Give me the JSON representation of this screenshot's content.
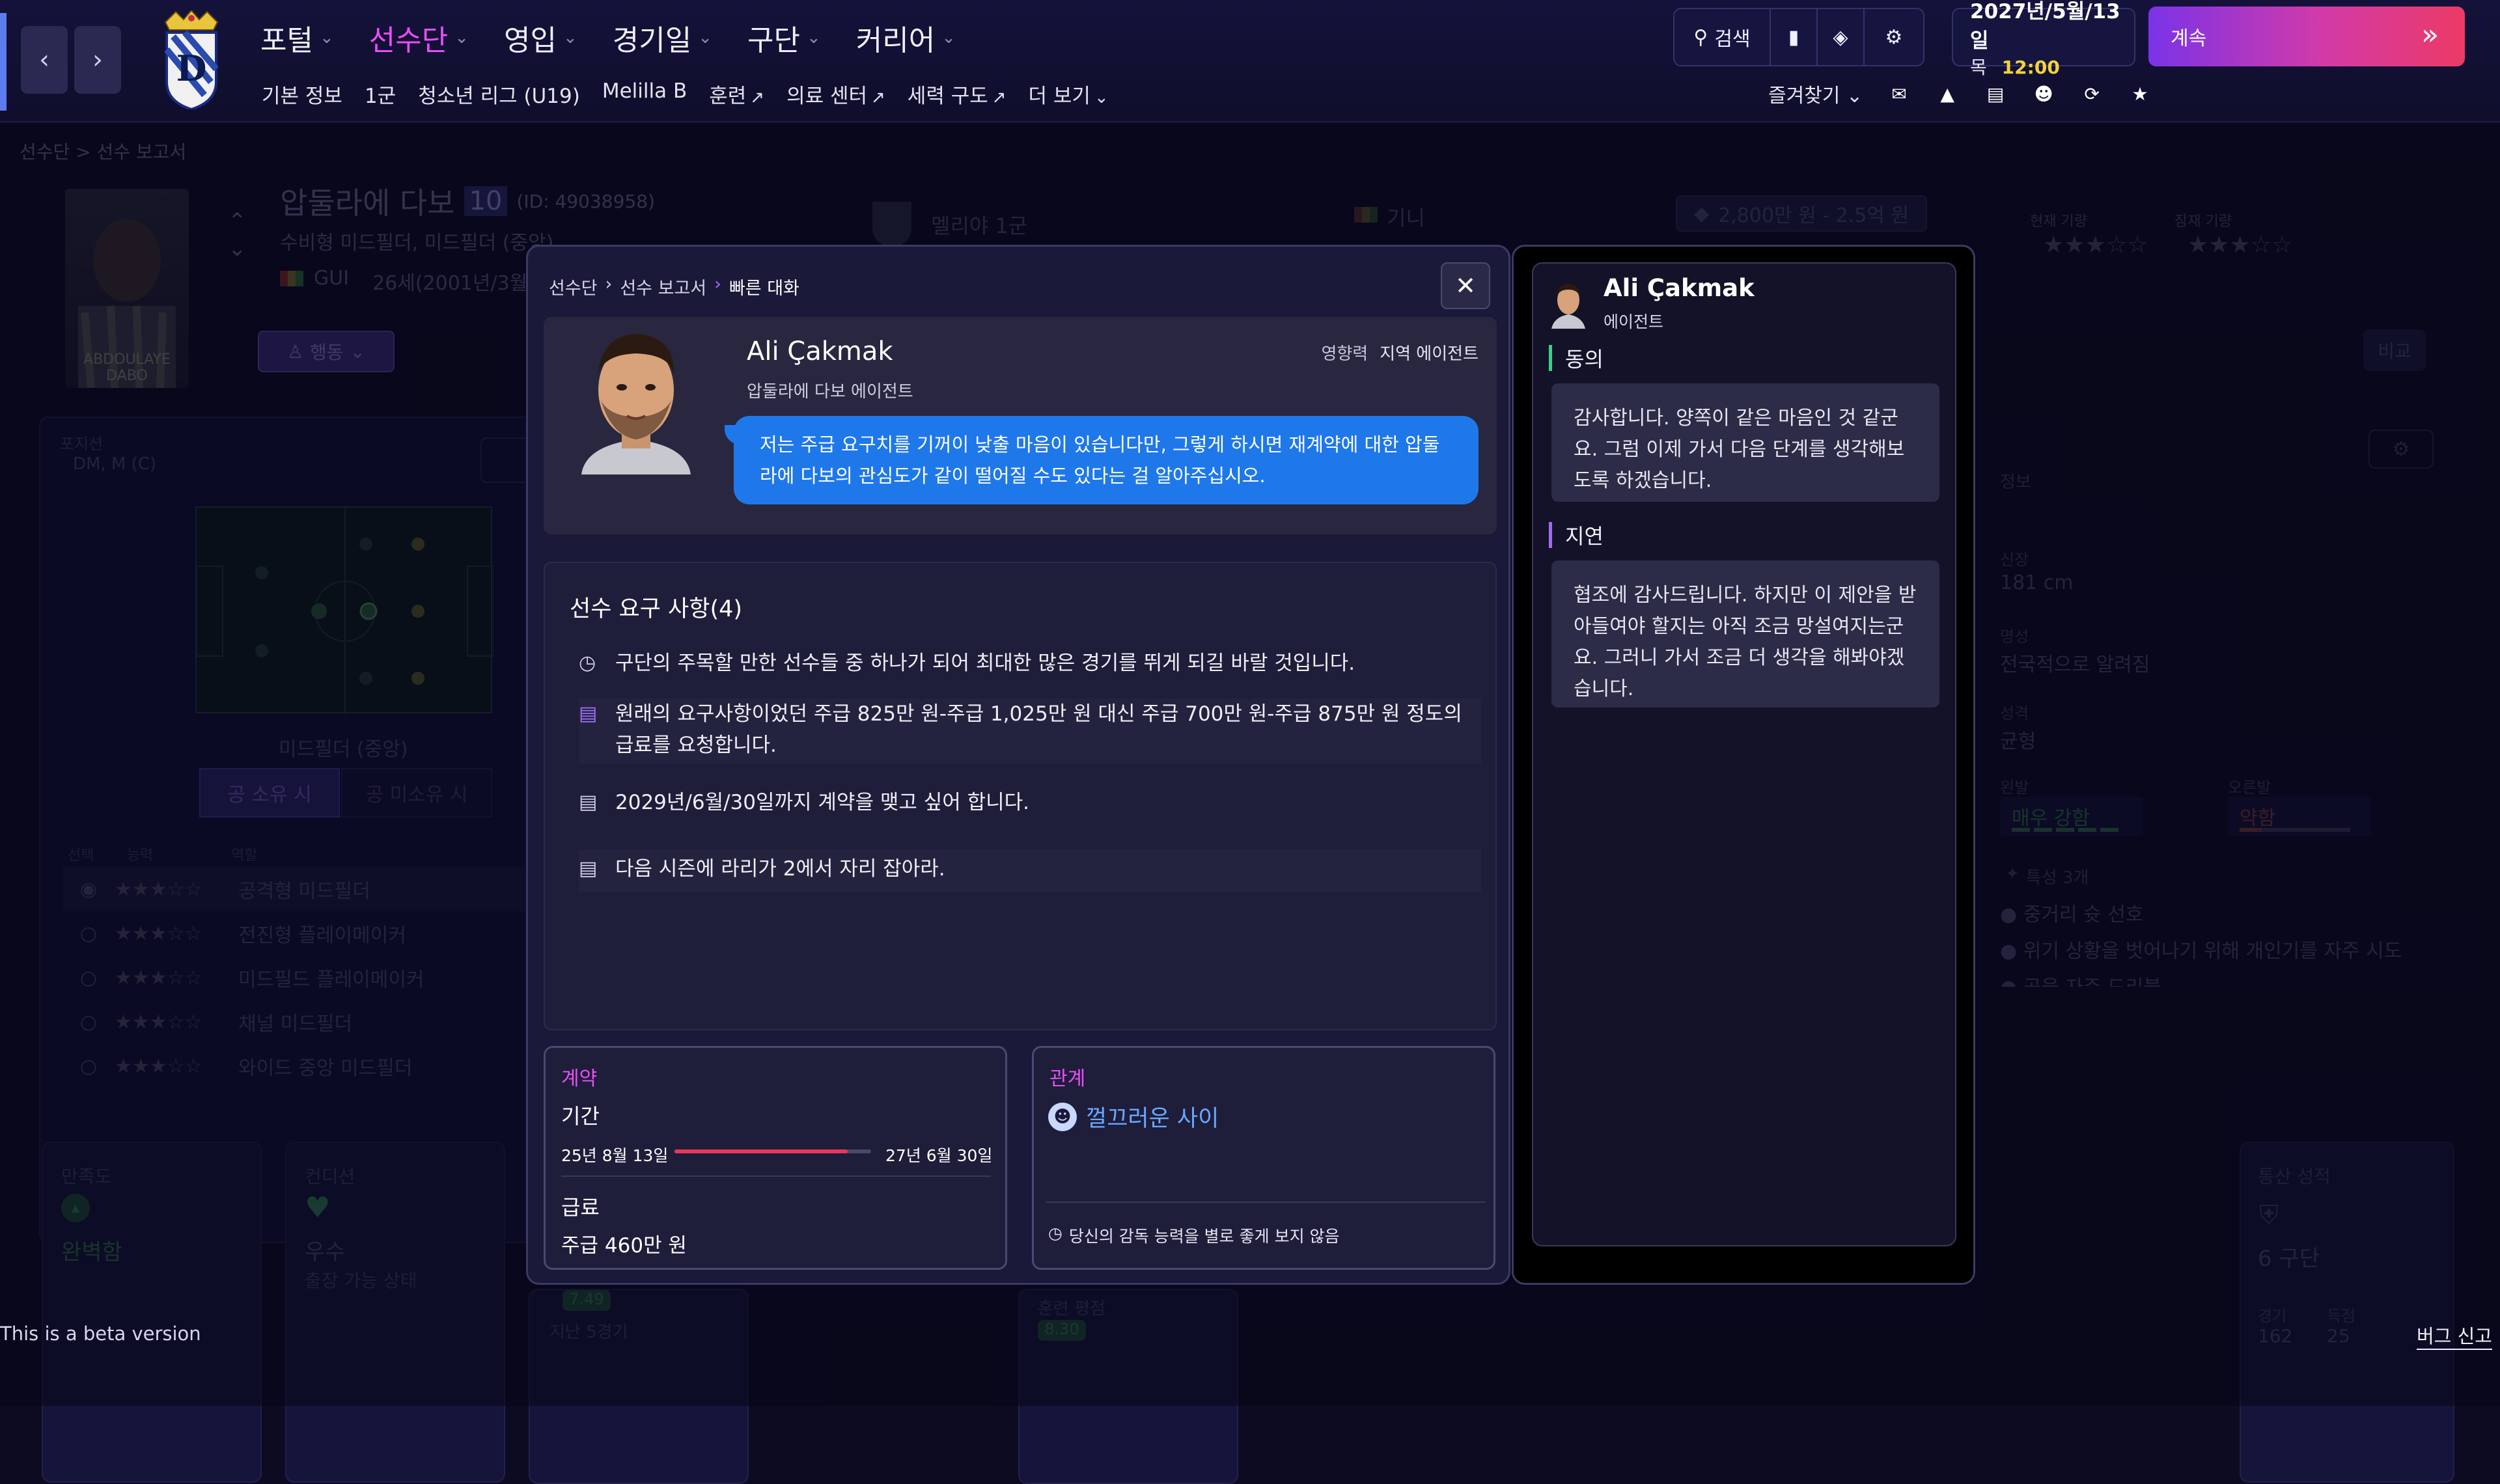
{
  "header": {
    "nav": {
      "portal": "포털",
      "squad": "선수단",
      "recruit": "영입",
      "schedule": "경기일",
      "club": "구단",
      "career": "커리어"
    },
    "subnav": [
      "기본 정보",
      "1군",
      "청소년 리그 (U19)",
      "Melilla B",
      "훈련",
      "의료 센터",
      "세력 구도",
      "더 보기"
    ],
    "search_label": "검색",
    "date_line1": "2027년/5월/13일",
    "date_line2_day": "목",
    "date_line2_time": "12:00",
    "continue_label": "계속",
    "favorites_label": "즐겨찾기"
  },
  "background": {
    "breadcrumb": "선수단 > 선수 보고서",
    "player_name": "압둘라에 다보",
    "player_number": "10",
    "player_id": "(ID: 49038958)",
    "player_role": "수비형 미드필더, 미드필더 (중앙)",
    "player_nation_code": "GUI",
    "player_age": "26세(2001년/3월/",
    "player_photo_caption": "ABDOULAYE DABO",
    "action_btn": "행동",
    "club_label": "멜리야 1군",
    "nation_label": "기니",
    "value_label": "2,800만 원 - 2.5억 원",
    "current_ability": "현재 기량",
    "potential_ability": "잠재 기량",
    "compare": "비교",
    "position_label": "포지션",
    "position_value": "DM, M (C)",
    "pitch_caption": "미드필더 (중앙)",
    "possession_on": "공 소유 시",
    "possession_off": "공 미소유 시",
    "role_col_select": "선택",
    "role_col_ability": "능력",
    "role_col_role": "역할",
    "roles": [
      "공격형 미드필더",
      "전진형 플레이메이커",
      "미드필드 플레이메이커",
      "채널 미드필더",
      "와이드 중앙 미드필더"
    ],
    "info_label": "정보",
    "height_label": "신장",
    "height_value": "181 cm",
    "fame_label": "명성",
    "fame_value": "전국적으로 알려짐",
    "personality_label": "성격",
    "personality_value": "균형",
    "left_foot_label": "왼발",
    "left_foot_value": "매우 강함",
    "right_foot_label": "오른발",
    "right_foot_value": "약함",
    "traits_label": "특성 3개",
    "traits": [
      "중거리 슛 선호",
      "위기 상황을 벗어나기 위해 개인기를 자주 시도",
      "공을 자주 드리블"
    ],
    "morale_label": "만족도",
    "morale_value": "완벽함",
    "condition_label": "컨디션",
    "condition_value": "우수",
    "condition_sub": "출장 가능 상태",
    "rating_value": "7.49",
    "last5_label": "지난 5경기",
    "training_label": "훈련 평점",
    "training_value": "8.30",
    "career_label": "통산 성적",
    "career_club": "6 구단",
    "career_matches_label": "경기",
    "career_matches": "162",
    "career_goals_label": "득점",
    "career_goals": "25",
    "beta_notice": "This is a beta version",
    "bug_report": "버그 신고"
  },
  "modal": {
    "breadcrumb_1": "선수단",
    "breadcrumb_2": "선수 보고서",
    "breadcrumb_3": "빠른 대화",
    "agent_name": "Ali Çakmak",
    "agent_subtitle": "압둘라에 다보 에이전트",
    "influence_label": "영향력",
    "influence_value": "지역 에이전트",
    "speech": "저는 주급 요구치를 기꺼이 낮출 마음이 있습니다만, 그렇게 하시면 재계약에 대한 압둘라에 다보의 관심도가 같이 떨어질 수도 있다는 걸 알아주십시오.",
    "requirements_title": "선수 요구 사항(4)",
    "requirements": [
      "구단의 주목할 만한 선수들 중 하나가 되어 최대한 많은 경기를 뛰게 되길 바랄 것입니다.",
      "원래의 요구사항이었던 주급 825만 원-주급 1,025만 원 대신 주급 700만 원-주급 875만 원 정도의 급료를 요청합니다.",
      "2029년/6월/30일까지 계약을 맺고 싶어 합니다.",
      "다음 시즌에 라리가 2에서 자리 잡아라."
    ],
    "contract": {
      "title": "계약",
      "period_label": "기간",
      "start": "25년 8월 13일",
      "end": "27년 6월 30일",
      "progress": 0.88,
      "wage_label": "급료",
      "wage_value": "주급 460만 원"
    },
    "relation": {
      "title": "관계",
      "status": "껄끄러운 사이",
      "note": "당신의 감독 능력을 별로 좋게 보지 않음"
    }
  },
  "agent_panel": {
    "name": "Ali Çakmak",
    "role": "에이전트",
    "options": [
      {
        "label": "동의",
        "text": "감사합니다. 양쪽이 같은 마음인 것 같군요. 그럼 이제 가서 다음 단계를 생각해보도록 하겠습니다.",
        "color": "#3bd08a"
      },
      {
        "label": "지연",
        "text": "협조에 감사드립니다. 하지만 이 제안을 받아들여야 할지는 아직 조금 망설여지는군요. 그러니 가서 조금 더 생각을 해봐야겠습니다.",
        "color": "#a06cf0"
      }
    ]
  },
  "colors": {
    "accent": "#e84ef6",
    "speech_blue": "#1f78ea",
    "contract_pink": "#e84ef6",
    "progress_red": "#e8385a"
  }
}
